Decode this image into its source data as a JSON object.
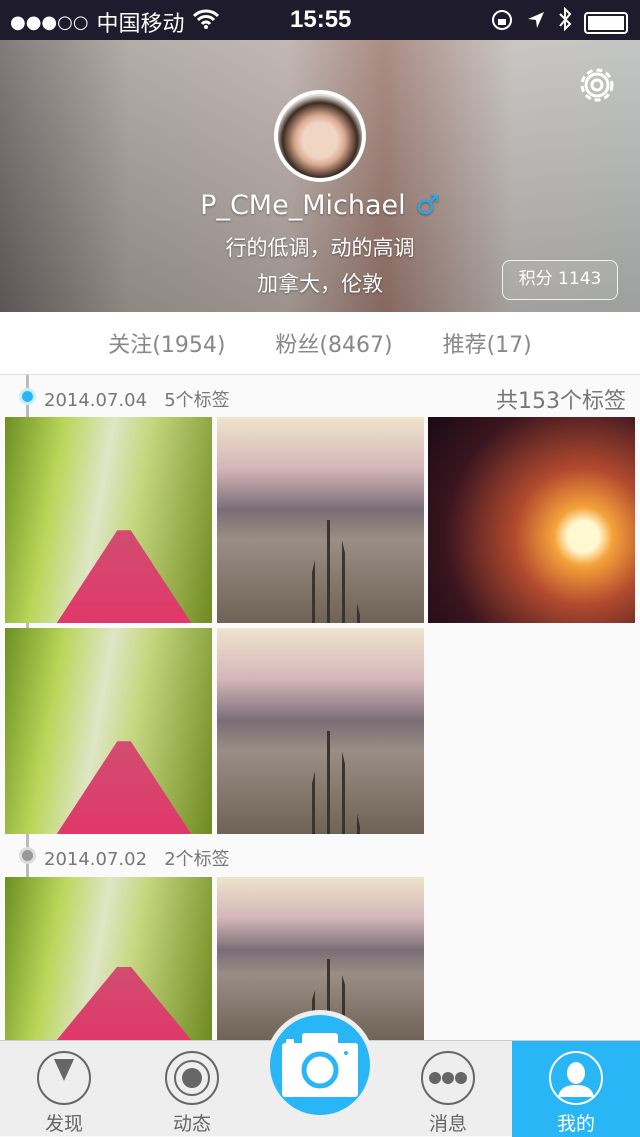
{
  "status_bar": {
    "signal": "●●●○○",
    "carrier": "中国移动",
    "time": "15:55"
  },
  "profile": {
    "username": "P_CMe_Michael",
    "gender_symbol": "♂",
    "bio_line1": "行的低调，动的高调",
    "bio_line2": "加拿大，伦敦",
    "score_label": "积分 1143"
  },
  "stats": {
    "following": "关注(1954)",
    "followers": "粉丝(8467)",
    "recommended": "推荐(17)"
  },
  "timeline": {
    "total": "共153个标签",
    "groups": [
      {
        "date": "2014.07.04",
        "count": "5个标签"
      },
      {
        "date": "2014.07.02",
        "count": "2个标签"
      }
    ]
  },
  "tabs": [
    {
      "label": "发现"
    },
    {
      "label": "动态"
    },
    {
      "label": "消息"
    },
    {
      "label": "我的"
    }
  ],
  "colors": {
    "accent": "#29b6f6"
  }
}
